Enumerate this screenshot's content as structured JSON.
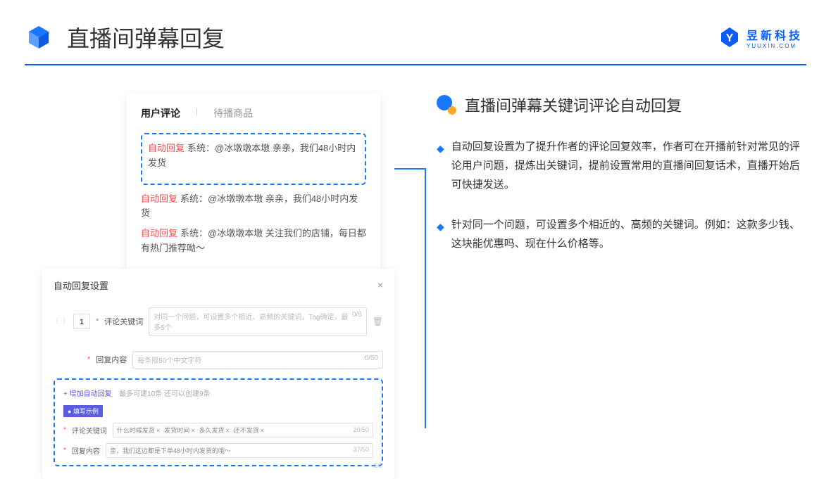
{
  "header": {
    "title": "直播间弹幕回复",
    "logo_cn": "昱新科技",
    "logo_en": "YUUXIN.COM"
  },
  "card1": {
    "tab1": "用户评论",
    "tab2": "待播商品",
    "l1_tag": "自动回复",
    "l1": "系统：@冰墩墩本墩 亲亲，我们48小时内发货",
    "l2_tag": "自动回复",
    "l2": "系统：@冰墩墩本墩 亲亲，我们48小时内发货",
    "l3_tag": "自动回复",
    "l3": "系统：@冰墩墩本墩 关注我们的店铺，每日都有热门推荐呦～"
  },
  "card2": {
    "title": "自动回复设置",
    "num": "1",
    "label1": "评论关键词",
    "ph1": "对同一个问题，可设置多个相近、高频的关键词，Tag确定，最多5个",
    "c1": "0/6",
    "label2": "回复内容",
    "ph2": "每条限50个中文字符",
    "c2": "0/50",
    "add": "+ 增加自动回复",
    "hint": "最多可建10条 还可以创建9条",
    "badge": "● 填写示例",
    "ex_l1": "评论关键词",
    "t1": "什么时候发货",
    "t2": "发货时间",
    "t3": "多久发货",
    "t4": "还不发货",
    "ec1": "20/50",
    "ex_l2": "回复内容",
    "ex_c": "亲，我们这边都是下单48小时内发货的哦～",
    "ec2": "37/50",
    "side": "/50"
  },
  "right": {
    "title": "直播间弹幕关键词评论自动回复",
    "b1": "自动回复设置为了提升作者的评论回复效率，作者可在开播前针对常见的评论用户问题，提炼出关键词，提前设置常用的直播间回复话术，直播开始后可快捷发送。",
    "b2": "针对同一个问题，可设置多个相近的、高频的关键词。例如：这款多少钱、这块能优惠吗、现在什么价格等。"
  }
}
